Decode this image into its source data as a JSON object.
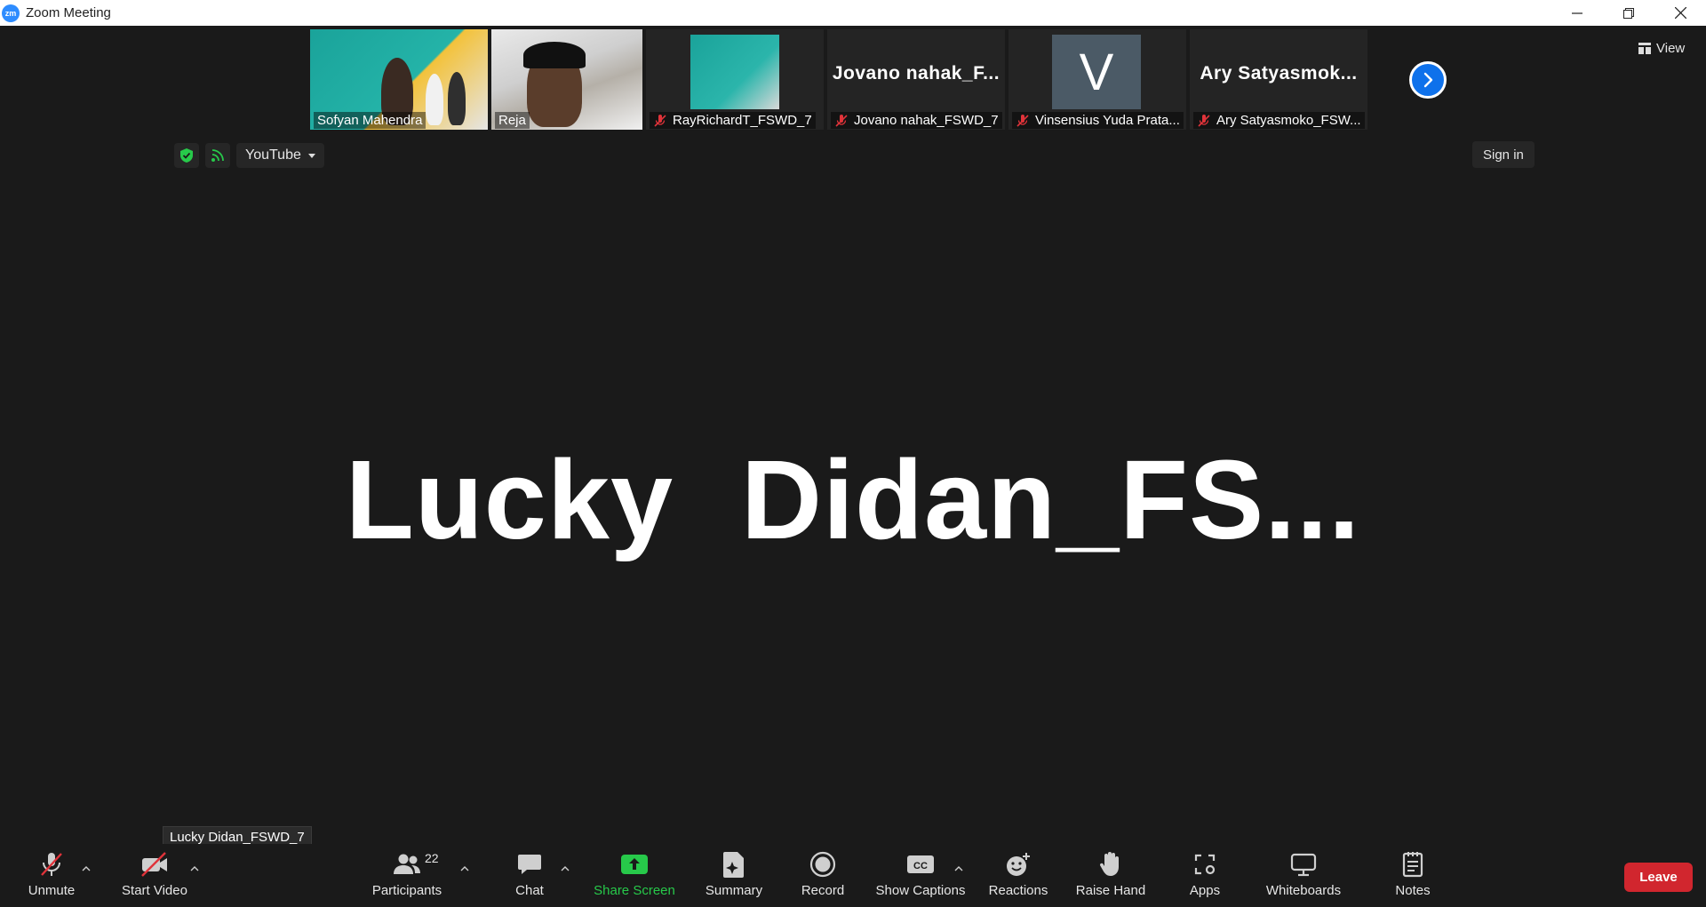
{
  "window": {
    "title": "Zoom Meeting",
    "logo_text": "zm"
  },
  "strip": {
    "tiles": [
      {
        "name": "Sofyan Mahendra",
        "muted": false
      },
      {
        "name": "Reja",
        "muted": false
      },
      {
        "name": "RayRichardT_FSWD_7",
        "muted": true
      },
      {
        "name": "Jovano nahak_FSWD_7",
        "muted": true,
        "big": "Jovano  nahak_F..."
      },
      {
        "name": "Vinsensius Yuda Prata...",
        "muted": true,
        "avatar_letter": "V"
      },
      {
        "name": "Ary Satyasmoko_FSW...",
        "muted": true,
        "big": "Ary  Satyasmok..."
      }
    ],
    "view_label": "View"
  },
  "stream": {
    "platform": "YouTube",
    "sign_in": "Sign in"
  },
  "active_speaker": {
    "display": "Lucky  Didan_FS...",
    "tooltip": "Lucky Didan_FSWD_7"
  },
  "toolbar": {
    "unmute": "Unmute",
    "start_video": "Start Video",
    "participants": "Participants",
    "participant_count": "22",
    "chat": "Chat",
    "share_screen": "Share Screen",
    "summary": "Summary",
    "record": "Record",
    "show_captions": "Show Captions",
    "reactions": "Reactions",
    "raise_hand": "Raise Hand",
    "apps": "Apps",
    "whiteboards": "Whiteboards",
    "notes": "Notes",
    "leave": "Leave"
  },
  "colors": {
    "accent": "#0e71eb",
    "leave": "#d1262e",
    "share": "#27c94a",
    "background": "#1a1a1a"
  }
}
